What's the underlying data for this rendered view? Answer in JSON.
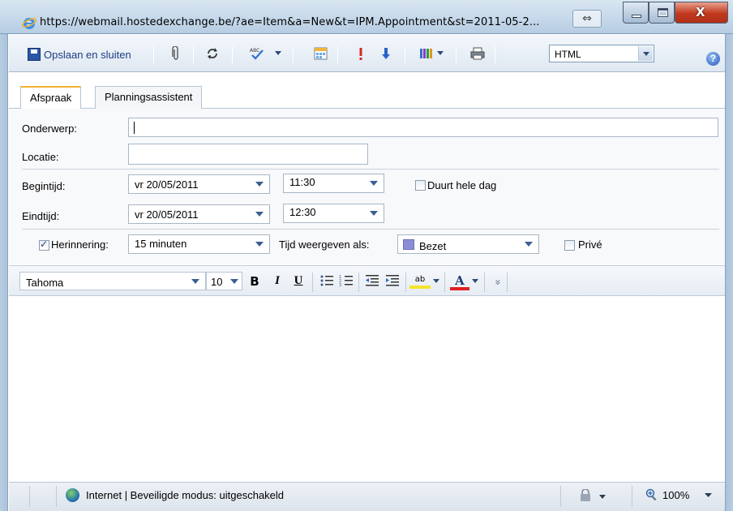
{
  "window": {
    "title": "https://webmail.hostedexchange.be/?ae=Item&a=New&t=IPM.Appointment&st=2011-05-2...",
    "sizer_glyph": "⇔",
    "close_glyph": "X"
  },
  "toolbar": {
    "save_label": "Opslaan en sluiten",
    "format_select": "HTML",
    "help_glyph": "?"
  },
  "tabs": [
    {
      "label": "Afspraak",
      "active": true
    },
    {
      "label": "Planningsassistent",
      "active": false
    }
  ],
  "form": {
    "subject_label": "Onderwerp:",
    "subject_value": "",
    "location_label": "Locatie:",
    "location_value": "",
    "start_label": "Begintijd:",
    "start_date": "vr 20/05/2011",
    "start_time": "11:30",
    "all_day_label": "Duurt hele dag",
    "all_day_checked": false,
    "end_label": "Eindtijd:",
    "end_date": "vr 20/05/2011",
    "end_time": "12:30",
    "reminder_label": "Herinnering:",
    "reminder_checked": true,
    "reminder_value": "15 minuten",
    "show_as_label": "Tijd weergeven als:",
    "show_as_value": "Bezet",
    "show_as_color": "#8b8ed6",
    "private_label": "Privé",
    "private_checked": false
  },
  "format": {
    "font_name": "Tahoma",
    "font_size": "10",
    "bold": "B",
    "italic": "I",
    "underline": "U",
    "highlight_glyph": "ab",
    "font_color_glyph": "A",
    "font_color": "#e02020",
    "more_glyph": "»"
  },
  "status": {
    "text": "Internet | Beveiligde modus: uitgeschakeld",
    "zoom": "100%"
  }
}
